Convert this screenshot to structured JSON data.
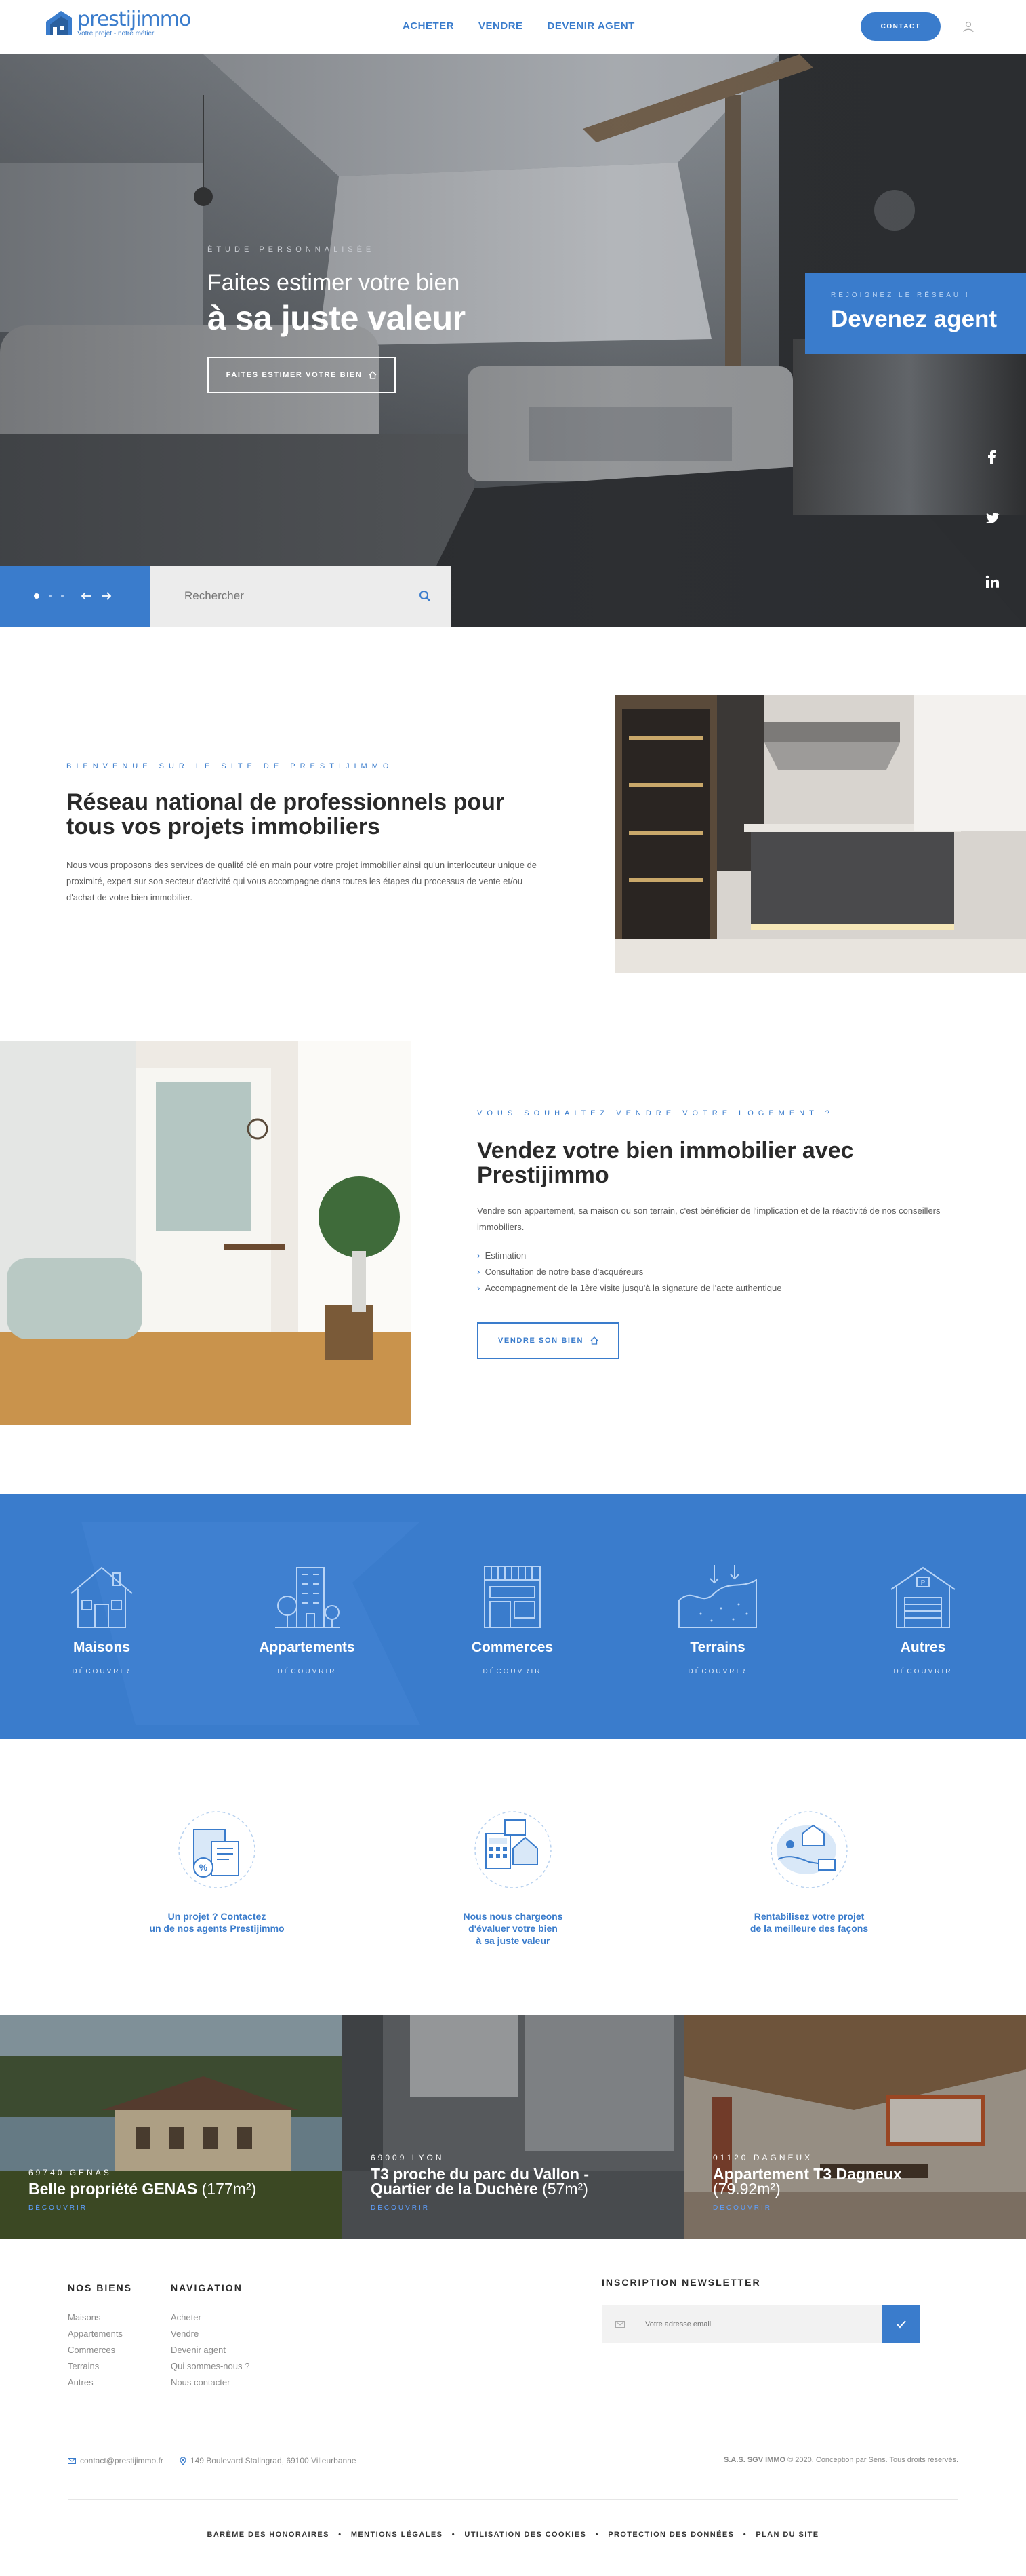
{
  "header": {
    "logo_name": "prestijimmo",
    "logo_tagline": "Votre projet - notre métier",
    "nav": [
      "ACHETER",
      "VENDRE",
      "DEVENIR AGENT"
    ],
    "contact_label": "CONTACT",
    "brand_color": "#3a7ccc"
  },
  "hero": {
    "kicker": "ÉTUDE PERSONNALISÉE",
    "line1": "Faites estimer votre bien",
    "line2": "à sa juste valeur",
    "button_label": "FAITES ESTIMER VOTRE BIEN",
    "agent_kicker": "REJOIGNEZ LE RÉSEAU !",
    "agent_title": "Devenez agent",
    "search_placeholder": "Rechercher",
    "social_icons": [
      "facebook-icon",
      "twitter-icon",
      "linkedin-icon"
    ]
  },
  "welcome": {
    "kicker": "BIENVENUE SUR LE SITE DE PRESTIJIMMO",
    "title": "Réseau national de professionnels pour tous vos projets immobiliers",
    "text": "Nous vous proposons des services de qualité clé en main pour votre projet immobilier ainsi qu'un interlocuteur unique de proximité, expert sur son secteur d'activité qui vous accompagne dans toutes les étapes du processus de vente et/ou d'achat de votre bien immobilier."
  },
  "sell": {
    "kicker": "VOUS SOUHAITEZ VENDRE VOTRE LOGEMENT ?",
    "title": "Vendez votre bien immobilier avec Prestijimmo",
    "text": "Vendre son appartement, sa maison ou son terrain, c'est bénéficier de l'implication et de la réactivité de nos conseillers immobiliers.",
    "items": [
      "Estimation",
      "Consultation de notre base d'acquéreurs",
      "Accompagnement de la 1ère visite jusqu'à la signature de l'acte authentique"
    ],
    "button_label": "VENDRE SON BIEN"
  },
  "categories": [
    {
      "name": "Maisons",
      "link": "DÉCOUVRIR",
      "icon": "house-icon"
    },
    {
      "name": "Appartements",
      "link": "DÉCOUVRIR",
      "icon": "building-icon"
    },
    {
      "name": "Commerces",
      "link": "DÉCOUVRIR",
      "icon": "shop-icon"
    },
    {
      "name": "Terrains",
      "link": "DÉCOUVRIR",
      "icon": "land-icon"
    },
    {
      "name": "Autres",
      "link": "DÉCOUVRIR",
      "icon": "garage-icon"
    }
  ],
  "features": [
    {
      "line1": "Un projet ? Contactez",
      "line2": "un de nos agents Prestijimmo",
      "line3": "",
      "line4": ""
    },
    {
      "line1": "Nous nous chargeons",
      "line2": "d'évaluer votre bien",
      "line3": "à sa juste valeur",
      "line4": ""
    },
    {
      "line1": "Rentabilisez votre projet",
      "line2": "de la meilleure des façons",
      "line3": "",
      "line4": ""
    }
  ],
  "properties": [
    {
      "location": "69740 GENAS",
      "title": "Belle propriété GENAS",
      "title2": "",
      "size": "(177m²)",
      "more": "DÉCOUVRIR"
    },
    {
      "location": "69009 LYON",
      "title": "T3 proche du parc du Vallon -",
      "title2": "Quartier de la Duchère",
      "size": "(57m²)",
      "more": "DÉCOUVRIR"
    },
    {
      "location": "01120 DAGNEUX",
      "title": "Appartement T3 Dagneux",
      "title2": "",
      "size": "(79.92m²)",
      "more": "DÉCOUVRIR"
    }
  ],
  "footer": {
    "col1_title": "NOS BIENS",
    "col1": [
      "Maisons",
      "Appartements",
      "Commerces",
      "Terrains",
      "Autres"
    ],
    "col2_title": "NAVIGATION",
    "col2": [
      "Acheter",
      "Vendre",
      "Devenir agent",
      "Qui sommes-nous ?",
      "Nous contacter"
    ],
    "newsletter_title": "INSCRIPTION NEWSLETTER",
    "newsletter_placeholder": "Votre adresse email",
    "email": "contact@prestijimmo.fr",
    "address": "149 Boulevard Stalingrad, 69100 Villeurbanne",
    "credit_company": "S.A.S. SGV IMMO",
    "credit_rest": "© 2020. Conception par Sens. Tous droits réservés.",
    "legal": [
      "BARÈME DES HONORAIRES",
      "MENTIONS LÉGALES",
      "UTILISATION DES COOKIES",
      "PROTECTION DES DONNÉES",
      "PLAN DU SITE"
    ]
  }
}
